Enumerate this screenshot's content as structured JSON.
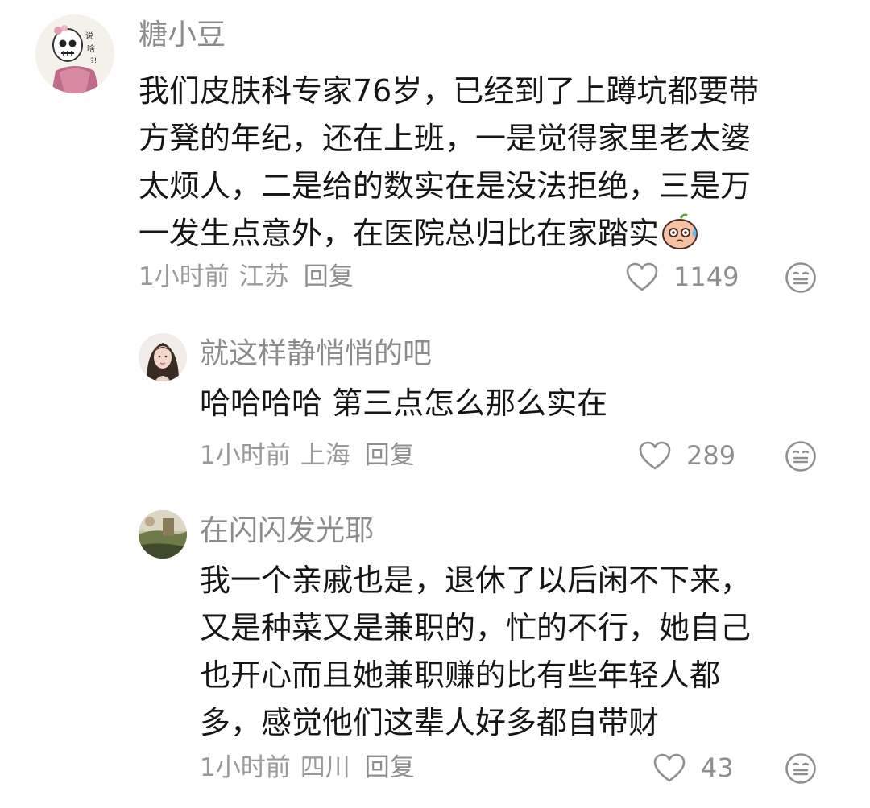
{
  "comments": [
    {
      "author": "糖小豆",
      "avatar_icon": "skull-girl-avatar",
      "text": "我们皮肤科专家76岁，已经到了上蹲坑都要带\n方凳的年纪，还在上班，一是觉得家里老太婆\n太烦人，二是给的数实在是没法拒绝，三是万\n一发生点意外，在医院总归比在家踏实",
      "emoji_icon": "sweat-face-emoji",
      "time": "1小时前",
      "location": "江苏",
      "reply_label": "回复",
      "likes": "1149"
    },
    {
      "author": "就这样静悄悄的吧",
      "avatar_icon": "woman-portrait-avatar",
      "text": "哈哈哈哈 第三点怎么那么实在",
      "time": "1小时前",
      "location": "上海",
      "reply_label": "回复",
      "likes": "289"
    },
    {
      "author": "在闪闪发光耶",
      "avatar_icon": "scenery-avatar",
      "text": "我一个亲戚也是，退休了以后闲不下来，\n又是种菜又是兼职的，忙的不行，她自己\n也开心而且她兼职赚的比有些年轻人都\n多，感觉他们这辈人好多都自带财",
      "time": "1小时前",
      "location": "四川",
      "reply_label": "回复",
      "likes": "43"
    }
  ],
  "colors": {
    "text": "#161616",
    "secondary": "#8c8c8c",
    "icon": "#8f8f8f"
  }
}
